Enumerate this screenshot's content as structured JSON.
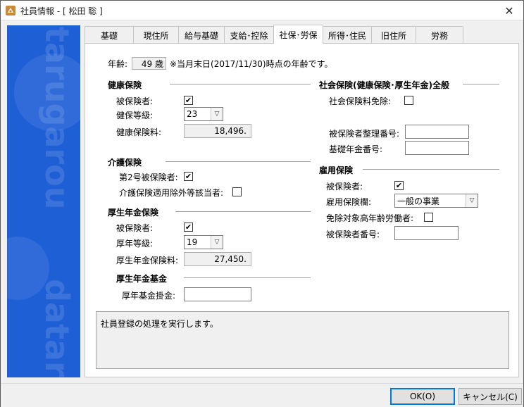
{
  "window": {
    "title": "社員情報 - [ 松田 聡 ]",
    "close_glyph": "✕"
  },
  "tabs": [
    {
      "label": "基礎"
    },
    {
      "label": "現住所"
    },
    {
      "label": "給与基礎"
    },
    {
      "label": "支給･控除"
    },
    {
      "label": "社保･労保"
    },
    {
      "label": "所得･住民"
    },
    {
      "label": "旧住所"
    },
    {
      "label": "労務"
    }
  ],
  "active_tab": "社保･労保",
  "age": {
    "label": "年齢:",
    "value": "49 歳",
    "note": "※当月末日(2017/11/30)時点の年齢です。"
  },
  "health": {
    "title": "健康保険",
    "insured_label": "被保険者:",
    "insured": true,
    "grade_label": "健保等級:",
    "grade": "23",
    "premium_label": "健康保険料:",
    "premium": "18,496."
  },
  "care": {
    "title": "介護保険",
    "no2_label": "第2号被保険者:",
    "no2": true,
    "exempt_label": "介護保険適用除外等該当者:",
    "exempt": false
  },
  "pension": {
    "title": "厚生年金保険",
    "insured_label": "被保険者:",
    "insured": true,
    "grade_label": "厚年等級:",
    "grade": "19",
    "premium_label": "厚生年金保険料:",
    "premium": "27,450."
  },
  "pension_fund": {
    "title": "厚生年金基金",
    "fee_label": "厚年基金掛金:",
    "fee": ""
  },
  "social_general": {
    "title": "社会保険(健康保険･厚生年金)全般",
    "exempt_label": "社会保険料免除:",
    "exempt": false,
    "ref_no_label": "被保険者整理番号:",
    "ref_no": "",
    "basic_pension_label": "基礎年金番号:",
    "basic_pension": ""
  },
  "employment": {
    "title": "雇用保険",
    "insured_label": "被保険者:",
    "insured": true,
    "column_label": "雇用保険欄:",
    "column": "一般の事業",
    "elderly_label": "免除対象高年齢労働者:",
    "elderly": false,
    "number_label": "被保険者番号:",
    "number": ""
  },
  "message": "社員登録の処理を実行します。",
  "buttons": {
    "ok": "OK(O)",
    "cancel": "キャンセル(C)"
  },
  "colors": {
    "side_panel": "#1f5fd6",
    "focus": "#0078d7"
  }
}
